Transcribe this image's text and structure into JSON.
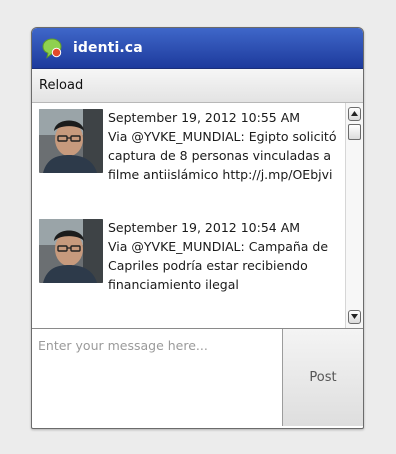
{
  "app": {
    "title": "identi.ca",
    "logo_icon": "identica-speech-bubble-icon",
    "brand_color": "#2a4db3"
  },
  "toolbar": {
    "reload_label": "Reload"
  },
  "feed": {
    "items": [
      {
        "date": "September 19, 2012 10:55 AM",
        "text": "Via @YVKE_MUNDIAL: Egipto solicitó captura de 8 personas vinculadas a filme antiislámico http://j.mp/OEbjvi",
        "avatar_icon": "user-avatar-photo"
      },
      {
        "date": "September 19, 2012 10:54 AM",
        "text": "Via @YVKE_MUNDIAL: Campaña de Capriles podría estar recibiendo financiamiento ilegal",
        "avatar_icon": "user-avatar-photo"
      }
    ],
    "scroll_up_icon": "arrow-up-icon",
    "scroll_down_icon": "arrow-down-icon"
  },
  "composer": {
    "placeholder": "Enter your message here...",
    "value": "",
    "post_label": "Post"
  }
}
